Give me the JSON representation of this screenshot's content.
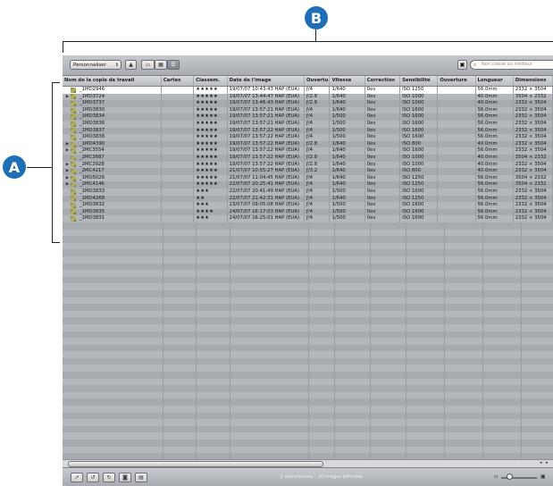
{
  "callouts": {
    "a": "A",
    "b": "B"
  },
  "toolbar": {
    "view_popup": "Personnaliser",
    "search_placeholder": "Non classé ou meilleur"
  },
  "columns": [
    "Nom de la copie de travail",
    "Cartes",
    "Classem.",
    "Date de l'image",
    "Ouvertu",
    "Vitesse",
    "Correction",
    "Sensibilité",
    "Ouverture",
    "Longueur",
    "Dimensions"
  ],
  "rows": [
    {
      "name": "_1MD2946",
      "stack": false,
      "stars": "★★★★★",
      "date": "19/07/07 10:43:43 HAP (ÉUA)",
      "aperture": "ƒ/4",
      "speed": "1/640",
      "correction": "0ev",
      "iso": "ISO 1250",
      "focal": "56.0mm",
      "dims": "2332 × 3504",
      "selected": true
    },
    {
      "name": "_1MD3724",
      "stack": true,
      "stars": "★★★★★",
      "date": "19/07/07 13:44:47 HAP (ÉUA)",
      "aperture": "ƒ/2.8",
      "speed": "1/640",
      "correction": "0ev",
      "iso": "ISO 1000",
      "focal": "40.0mm",
      "dims": "3504 × 2332"
    },
    {
      "name": "_1MD3737",
      "stack": false,
      "stars": "★★★★★",
      "date": "19/07/07 13:46:43 HAP (ÉUA)",
      "aperture": "ƒ/2.8",
      "speed": "1/640",
      "correction": "0ev",
      "iso": "ISO 1000",
      "focal": "40.0mm",
      "dims": "2332 × 3504"
    },
    {
      "name": "_1MD3830",
      "stack": false,
      "stars": "★★★★★",
      "date": "19/07/07 13:57:21 HAP (ÉUA)",
      "aperture": "ƒ/4",
      "speed": "1/640",
      "correction": "0ev",
      "iso": "ISO 1600",
      "focal": "56.0mm",
      "dims": "2332 × 3504"
    },
    {
      "name": "_1MD3834",
      "stack": false,
      "stars": "★★★★★",
      "date": "19/07/07 13:57:21 HAP (ÉUA)",
      "aperture": "ƒ/4",
      "speed": "1/500",
      "correction": "0ev",
      "iso": "ISO 1600",
      "focal": "56.0mm",
      "dims": "2332 × 3504"
    },
    {
      "name": "_1MD3836",
      "stack": false,
      "stars": "★★★★★",
      "date": "19/07/07 13:57:21 HAP (ÉUA)",
      "aperture": "ƒ/4",
      "speed": "1/500",
      "correction": "0ev",
      "iso": "ISO 1600",
      "focal": "56.0mm",
      "dims": "2332 × 3504"
    },
    {
      "name": "_1MD3837",
      "stack": false,
      "stars": "★★★★★",
      "date": "19/07/07 13:57:22 HAP (ÉUA)",
      "aperture": "ƒ/4",
      "speed": "1/500",
      "correction": "0ev",
      "iso": "ISO 1600",
      "focal": "56.0mm",
      "dims": "2332 × 3504"
    },
    {
      "name": "_1MD3838",
      "stack": false,
      "stars": "★★★★★",
      "date": "19/07/07 13:57:22 HAP (ÉUA)",
      "aperture": "ƒ/4",
      "speed": "1/500",
      "correction": "0ev",
      "iso": "ISO 1600",
      "focal": "56.0mm",
      "dims": "2332 × 3504"
    },
    {
      "name": "_1MD4390",
      "stack": true,
      "stars": "★★★★★",
      "date": "19/07/07 13:57:22 HAP (ÉUA)",
      "aperture": "ƒ/2.8",
      "speed": "1/640",
      "correction": "0ev",
      "iso": "ISO 800",
      "focal": "40.0mm",
      "dims": "2332 × 3504"
    },
    {
      "name": "_2MC3554",
      "stack": true,
      "stars": "★★★★★",
      "date": "19/07/07 13:57:22 HAP (ÉUA)",
      "aperture": "ƒ/4",
      "speed": "1/640",
      "correction": "0ev",
      "iso": "ISO 1600",
      "focal": "56.0mm",
      "dims": "2332 × 3504"
    },
    {
      "name": "_2MC3687",
      "stack": false,
      "stars": "★★★★★",
      "date": "19/07/07 13:57:22 HAP (ÉUA)",
      "aperture": "ƒ/2.8",
      "speed": "1/640",
      "correction": "0ev",
      "iso": "ISO 1000",
      "focal": "40.0mm",
      "dims": "3504 × 2332",
      "wide": true
    },
    {
      "name": "_2MC3928",
      "stack": true,
      "stars": "★★★★★",
      "date": "19/07/07 13:57:22 HAP (ÉUA)",
      "aperture": "ƒ/2.8",
      "speed": "1/640",
      "correction": "0ev",
      "iso": "ISO 1000",
      "focal": "40.0mm",
      "dims": "2332 × 3504"
    },
    {
      "name": "_2MC4217",
      "stack": true,
      "stars": "★★★★★",
      "date": "21/07/07 10:55:27 HAP (ÉUA)",
      "aperture": "ƒ/3.2",
      "speed": "1/640",
      "correction": "0ev",
      "iso": "ISO 800",
      "focal": "40.0mm",
      "dims": "2332 × 3504"
    },
    {
      "name": "_1MD5026",
      "stack": true,
      "stars": "★★★★★",
      "date": "21/07/07 11:04:45 HAP (ÉUA)",
      "aperture": "ƒ/4",
      "speed": "1/640",
      "correction": "0ev",
      "iso": "ISO 1250",
      "focal": "56.0mm",
      "dims": "3504 × 2332"
    },
    {
      "name": "_2MC4146",
      "stack": true,
      "stars": "★★★★★",
      "date": "22/07/07 20:25:41 HAP (ÉUA)",
      "aperture": "ƒ/4",
      "speed": "1/640",
      "correction": "0ev",
      "iso": "ISO 1250",
      "focal": "56.0mm",
      "dims": "3504 × 2332",
      "wide": true
    },
    {
      "name": "_1MD3833",
      "stack": false,
      "stars": "★★★",
      "date": "22/07/07 20:41:49 HAP (ÉUA)",
      "aperture": "ƒ/4",
      "speed": "1/500",
      "correction": "0ev",
      "iso": "ISO 1600",
      "focal": "56.0mm",
      "dims": "2332 × 3504"
    },
    {
      "name": "_1MD4268",
      "stack": false,
      "stars": "★★",
      "date": "22/07/07 21:42:31 HAP (ÉUA)",
      "aperture": "ƒ/4",
      "speed": "1/640",
      "correction": "0ev",
      "iso": "ISO 1250",
      "focal": "56.0mm",
      "dims": "2332 × 3504"
    },
    {
      "name": "_1MD3832",
      "stack": false,
      "stars": "★★★",
      "date": "23/07/07 09:05:08 HAP (ÉUA)",
      "aperture": "ƒ/4",
      "speed": "1/500",
      "correction": "0ev",
      "iso": "ISO 1600",
      "focal": "56.0mm",
      "dims": "2332 × 3504"
    },
    {
      "name": "_1MD3835",
      "stack": false,
      "stars": "★★★★",
      "date": "24/07/07 16:17:03 HAP (ÉUA)",
      "aperture": "ƒ/4",
      "speed": "1/500",
      "correction": "0ev",
      "iso": "ISO 1600",
      "focal": "56.0mm",
      "dims": "2332 × 3504"
    },
    {
      "name": "_1MD3831",
      "stack": false,
      "stars": "★★★",
      "date": "24/07/07 16:25:01 HAP (ÉUA)",
      "aperture": "ƒ/4",
      "speed": "1/500",
      "correction": "0ev",
      "iso": "ISO 1600",
      "focal": "56.0mm",
      "dims": "2332 × 3504"
    }
  ],
  "status": "1 sélectionnée – 20 images affichées",
  "icons": {
    "toolbar": [
      "stack-up-icon",
      "filmstrip-view-icon",
      "grid-view-icon",
      "list-view-icon",
      "viewer-icon",
      "search-icon"
    ],
    "bottom": [
      "pointer-tool-icon",
      "rotate-left-icon",
      "rotate-right-icon",
      "lift-tool-icon",
      "stamp-tool-icon"
    ]
  },
  "colors": {
    "callout": "#1f6fb8",
    "selected_row": "#ffffff",
    "row_even": "#b4b8bc",
    "row_odd": "#a7abb0"
  }
}
